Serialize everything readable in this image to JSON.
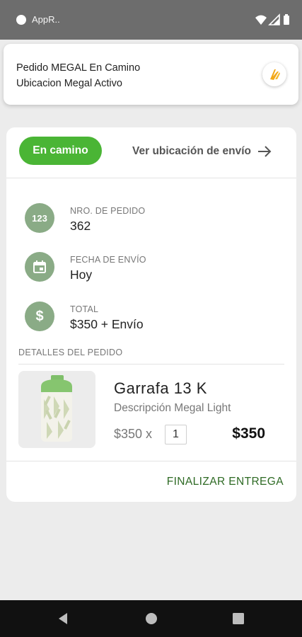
{
  "status_bar": {
    "app_name": "AppR.."
  },
  "notification": {
    "line1": "Pedido MEGAL En Camino",
    "line2": "Ubicacion Megal Activo"
  },
  "order": {
    "status_label": "En camino",
    "ship_link_label": "Ver ubicación de envío",
    "fields": [
      {
        "icon": "123",
        "label": "NRO. DE PEDIDO",
        "value": "362"
      },
      {
        "icon": "calendar-icon",
        "label": "FECHA DE ENVÍO",
        "value": "Hoy"
      },
      {
        "icon": "dollar-icon",
        "label": "TOTAL",
        "value": "$350 + Envío"
      }
    ],
    "details_label": "DETALLES DEL PEDIDO",
    "item": {
      "name": "Garrafa 13 K",
      "description": "Descripción Megal Light",
      "unit_price": "$350 x",
      "quantity": "1",
      "total": "$350"
    },
    "finalize_label": "FINALIZAR ENTREGA"
  },
  "colors": {
    "accent_green": "#4ab535",
    "icon_circle": "#8aab86",
    "link_dark_green": "#2e6a24"
  }
}
